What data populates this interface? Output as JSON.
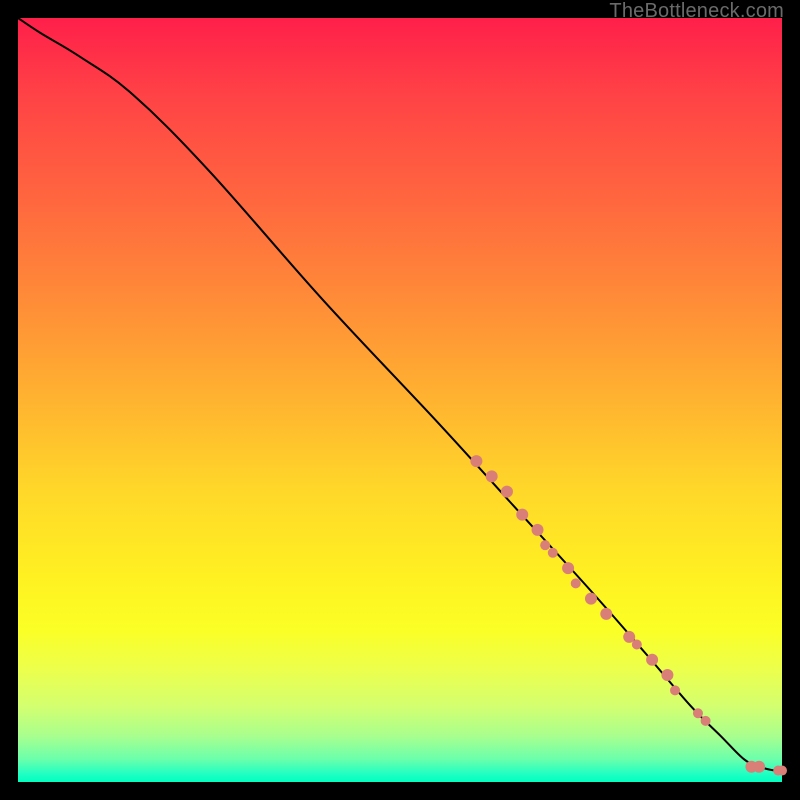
{
  "watermark": "TheBottleneck.com",
  "chart_data": {
    "type": "line",
    "title": "",
    "xlabel": "",
    "ylabel": "",
    "xlim": [
      0,
      100
    ],
    "ylim": [
      0,
      100
    ],
    "series": [
      {
        "name": "curve",
        "x": [
          0,
          3,
          8,
          15,
          25,
          40,
          55,
          65,
          75,
          82,
          88,
          92,
          95,
          97,
          99,
          100
        ],
        "y": [
          100,
          98,
          95,
          90,
          80,
          63,
          47,
          36,
          25,
          17,
          10,
          6,
          3,
          2,
          1.5,
          1.5
        ],
        "stroke": "#000000",
        "stroke_width": 2
      }
    ],
    "markers": [
      {
        "name": "cluster-upper",
        "x": 60,
        "y": 42,
        "r": 6,
        "fill": "#d97f78"
      },
      {
        "name": "cluster-upper",
        "x": 62,
        "y": 40,
        "r": 6,
        "fill": "#d97f78"
      },
      {
        "name": "cluster-upper",
        "x": 64,
        "y": 38,
        "r": 6,
        "fill": "#d97f78"
      },
      {
        "name": "cluster-upper",
        "x": 66,
        "y": 35,
        "r": 6,
        "fill": "#d97f78"
      },
      {
        "name": "cluster-upper",
        "x": 68,
        "y": 33,
        "r": 6,
        "fill": "#d97f78"
      },
      {
        "name": "cluster-upper",
        "x": 69,
        "y": 31,
        "r": 5,
        "fill": "#d97f78"
      },
      {
        "name": "cluster-upper",
        "x": 70,
        "y": 30,
        "r": 5,
        "fill": "#d97f78"
      },
      {
        "name": "cluster-upper",
        "x": 72,
        "y": 28,
        "r": 6,
        "fill": "#d97f78"
      },
      {
        "name": "cluster-upper",
        "x": 73,
        "y": 26,
        "r": 5,
        "fill": "#d97f78"
      },
      {
        "name": "cluster-upper",
        "x": 75,
        "y": 24,
        "r": 6,
        "fill": "#d97f78"
      },
      {
        "name": "cluster-upper",
        "x": 77,
        "y": 22,
        "r": 6,
        "fill": "#d97f78"
      },
      {
        "name": "cluster-mid",
        "x": 80,
        "y": 19,
        "r": 6,
        "fill": "#d97f78"
      },
      {
        "name": "cluster-mid",
        "x": 81,
        "y": 18,
        "r": 5,
        "fill": "#d97f78"
      },
      {
        "name": "cluster-mid",
        "x": 83,
        "y": 16,
        "r": 6,
        "fill": "#d97f78"
      },
      {
        "name": "cluster-mid",
        "x": 85,
        "y": 14,
        "r": 6,
        "fill": "#d97f78"
      },
      {
        "name": "cluster-mid",
        "x": 86,
        "y": 12,
        "r": 5,
        "fill": "#d97f78"
      },
      {
        "name": "cluster-low",
        "x": 89,
        "y": 9,
        "r": 5,
        "fill": "#d97f78"
      },
      {
        "name": "cluster-low",
        "x": 90,
        "y": 8,
        "r": 5,
        "fill": "#d97f78"
      },
      {
        "name": "cluster-end",
        "x": 96,
        "y": 2,
        "r": 6,
        "fill": "#d97f78"
      },
      {
        "name": "cluster-end",
        "x": 97,
        "y": 2,
        "r": 6,
        "fill": "#d97f78"
      },
      {
        "name": "cluster-tail",
        "x": 99.5,
        "y": 1.5,
        "r": 5,
        "fill": "#d97f78"
      },
      {
        "name": "cluster-tail",
        "x": 100,
        "y": 1.5,
        "r": 5,
        "fill": "#d97f78"
      }
    ]
  }
}
